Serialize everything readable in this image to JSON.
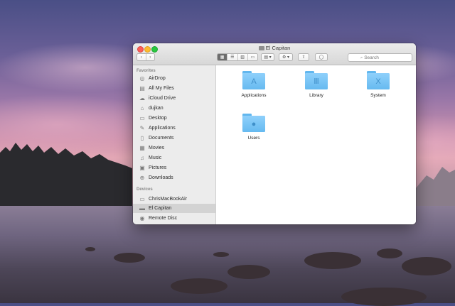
{
  "window": {
    "title": "El Capitan",
    "search_placeholder": "Search"
  },
  "toolbar": {
    "back_label": "‹",
    "forward_label": "›",
    "view_icons": [
      "icon-view-icon",
      "list-view-icon",
      "column-view-icon",
      "cover-flow-icon"
    ],
    "arrange_label": "▤ ▾",
    "action_label": "⚙ ▾",
    "share_label": "⇪",
    "tag_label": "◯"
  },
  "sidebar": {
    "favorites_header": "Favorites",
    "favorites": [
      {
        "label": "AirDrop",
        "icon": "airdrop-icon",
        "glyph": "◎"
      },
      {
        "label": "All My Files",
        "icon": "all-files-icon",
        "glyph": "▤"
      },
      {
        "label": "iCloud Drive",
        "icon": "cloud-icon",
        "glyph": "☁"
      },
      {
        "label": "dujkan",
        "icon": "home-icon",
        "glyph": "⌂"
      },
      {
        "label": "Desktop",
        "icon": "desktop-icon",
        "glyph": "▭"
      },
      {
        "label": "Applications",
        "icon": "applications-icon",
        "glyph": "✎"
      },
      {
        "label": "Documents",
        "icon": "documents-icon",
        "glyph": "▯"
      },
      {
        "label": "Movies",
        "icon": "movies-icon",
        "glyph": "▦"
      },
      {
        "label": "Music",
        "icon": "music-icon",
        "glyph": "♫"
      },
      {
        "label": "Pictures",
        "icon": "pictures-icon",
        "glyph": "▣"
      },
      {
        "label": "Downloads",
        "icon": "downloads-icon",
        "glyph": "⊕"
      }
    ],
    "devices_header": "Devices",
    "devices": [
      {
        "label": "ChrisMacBookAir",
        "icon": "laptop-icon",
        "glyph": "▭",
        "selected": false
      },
      {
        "label": "El Capitan",
        "icon": "disk-icon",
        "glyph": "▬",
        "selected": true
      },
      {
        "label": "Remote Disc",
        "icon": "disc-icon",
        "glyph": "◉",
        "selected": false
      }
    ]
  },
  "content": {
    "items": [
      {
        "label": "Applications",
        "icon": "applications-folder-icon",
        "glyph": "A"
      },
      {
        "label": "Library",
        "icon": "library-folder-icon",
        "glyph": "Ⅲ"
      },
      {
        "label": "System",
        "icon": "system-folder-icon",
        "glyph": "X"
      },
      {
        "label": "Users",
        "icon": "users-folder-icon",
        "glyph": "●"
      }
    ]
  },
  "colors": {
    "folder": "#66baf0",
    "selection": "#d3d3d3",
    "close": "#fc5f57",
    "minimize": "#fdbc2e",
    "zoom": "#28c840"
  }
}
